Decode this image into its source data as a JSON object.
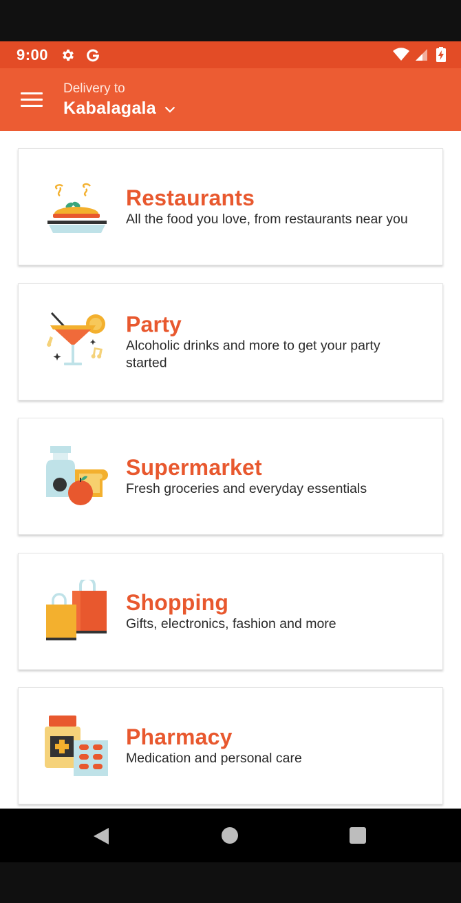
{
  "status_bar": {
    "time": "9:00",
    "icons": [
      "settings-gear-icon",
      "google-g-icon",
      "wifi-icon",
      "cell-signal-icon",
      "battery-charging-icon"
    ]
  },
  "app_bar": {
    "delivery_label": "Delivery to",
    "location": "Kabalagala"
  },
  "categories": [
    {
      "title": "Restaurants",
      "description": "All the food you love, from restaurants near you",
      "icon": "restaurant-food-plate-icon"
    },
    {
      "title": "Party",
      "description": "Alcoholic drinks and more to get your party started",
      "icon": "cocktail-party-icon"
    },
    {
      "title": "Supermarket",
      "description": "Fresh groceries and everyday essentials",
      "icon": "groceries-icon"
    },
    {
      "title": "Shopping",
      "description": "Gifts, electronics, fashion and more",
      "icon": "shopping-bags-icon"
    },
    {
      "title": "Pharmacy",
      "description": "Medication and personal care",
      "icon": "pharmacy-pills-icon"
    }
  ],
  "colors": {
    "status_bar": "#E34C26",
    "app_bar": "#EC5C33",
    "accent_title": "#E8582E"
  }
}
